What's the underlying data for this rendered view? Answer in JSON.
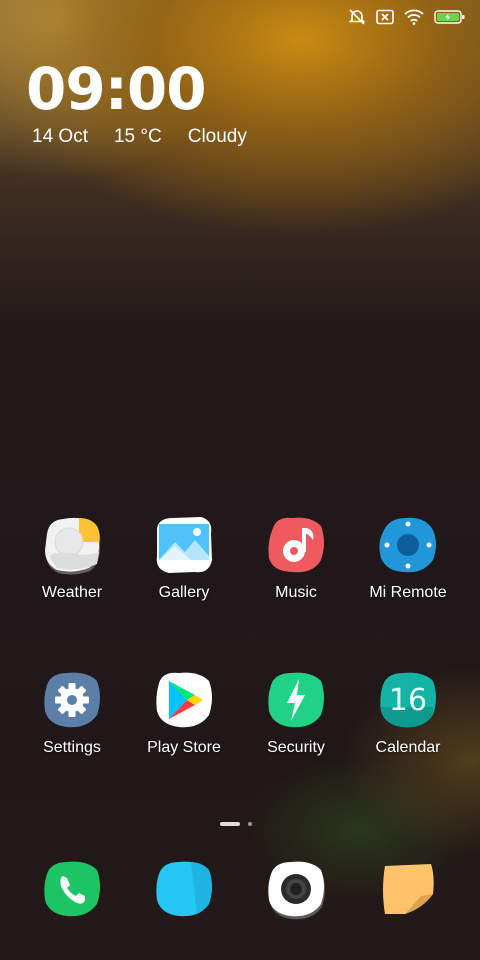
{
  "status_bar": {
    "icons": [
      "alarm-off-icon",
      "no-sim-icon",
      "wifi-icon",
      "battery-charging-icon"
    ]
  },
  "clock": {
    "time": "09:00",
    "date": "14 Oct",
    "temperature": "15 °C",
    "condition": "Cloudy"
  },
  "apps": [
    {
      "label": "Weather",
      "icon": "weather-icon"
    },
    {
      "label": "Gallery",
      "icon": "gallery-icon"
    },
    {
      "label": "Music",
      "icon": "music-icon"
    },
    {
      "label": "Mi Remote",
      "icon": "mi-remote-icon"
    },
    {
      "label": "Settings",
      "icon": "settings-icon"
    },
    {
      "label": "Play Store",
      "icon": "play-store-icon"
    },
    {
      "label": "Security",
      "icon": "security-icon"
    },
    {
      "label": "Calendar",
      "icon": "calendar-icon",
      "badge_text": "16"
    }
  ],
  "page_indicator": {
    "pages": 2,
    "current": 1
  },
  "dock": [
    {
      "icon": "phone-icon"
    },
    {
      "icon": "messaging-icon"
    },
    {
      "icon": "camera-icon"
    },
    {
      "icon": "notes-icon"
    }
  ],
  "colors": {
    "weather": "#f2f2f2",
    "gallery": "#29b6f6",
    "music": "#ef5a5f",
    "mi_remote": "#2196d8",
    "settings": "#5b7fa8",
    "security": "#1fd286",
    "calendar": "#14b3a6",
    "phone": "#1cc464",
    "messaging": "#26c6f2",
    "notes": "#ffc46b"
  }
}
